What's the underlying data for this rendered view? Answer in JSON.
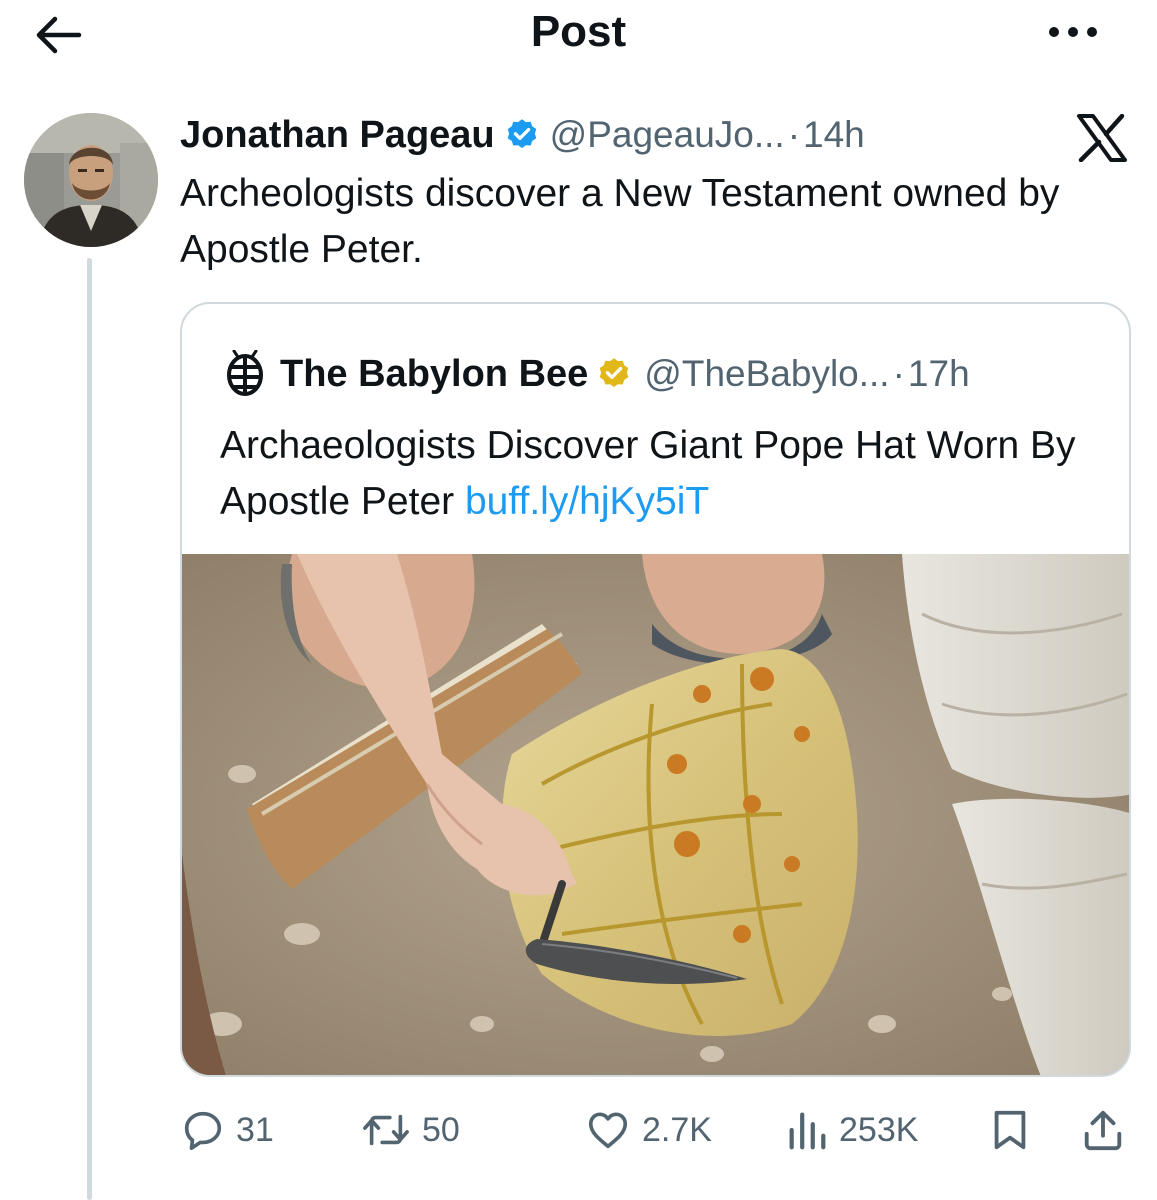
{
  "header": {
    "title": "Post",
    "back_icon": "arrow-left-icon",
    "more_icon": "more-horizontal-icon"
  },
  "post": {
    "author_name": "Jonathan Pageau",
    "handle": "@PageauJo...",
    "separator": "·",
    "time": "14h",
    "text": "Archeologists discover a New Testament owned by Apostle Peter.",
    "verified_color": "#1d9bf0"
  },
  "quote": {
    "author_name": "The Babylon Bee",
    "handle": "@TheBabylo...",
    "separator": "·",
    "time": "17h",
    "text": "Archaeologists Discover Giant Pope Hat Worn By Apostle Peter",
    "link": "buff.ly/hjKy5iT",
    "badge_color": "#e2b719"
  },
  "actions": {
    "replies": "31",
    "reposts": "50",
    "likes": "2.7K",
    "views": "253K"
  },
  "colors": {
    "text": "#0f1419",
    "secondary": "#536471",
    "link": "#1d9bf0",
    "border": "#cfd9de"
  }
}
